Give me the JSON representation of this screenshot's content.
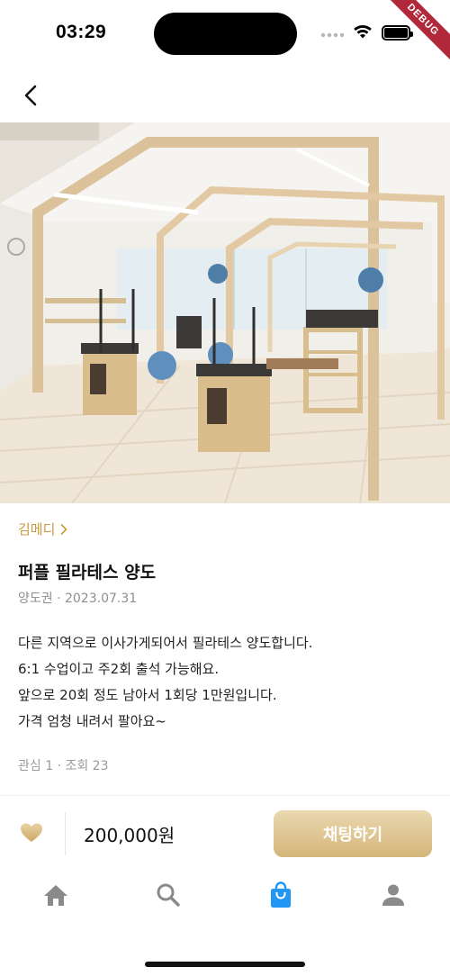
{
  "status_bar": {
    "time": "03:29",
    "debug_label": "DEBUG"
  },
  "header": {
    "back_icon": "chevron-left-icon"
  },
  "listing": {
    "seller_name": "김메디",
    "title": "퍼플 필라테스 양도",
    "meta": "양도권 · 2023.07.31",
    "description_lines": [
      "다른 지역으로 이사가게되어서 필라테스 양도합니다.",
      "6:1 수업이고  주2회 출석 가능해요.",
      "앞으로 20회 정도 남아서 1회당 1만원입니다.",
      "가격 엄청 내려서 팔아요~"
    ],
    "stats": "관심 1 · 조회 23"
  },
  "action_bar": {
    "price": "200,000원",
    "chat_label": "채팅하기",
    "like_icon": "heart-icon"
  },
  "tab_bar": {
    "tabs": [
      {
        "icon": "home-icon",
        "active": false
      },
      {
        "icon": "search-icon",
        "active": false
      },
      {
        "icon": "shopping-bag-icon",
        "active": true
      },
      {
        "icon": "person-icon",
        "active": false
      }
    ]
  },
  "colors": {
    "accent_gold": "#c89a3c",
    "button_gold": "#d5b67a",
    "active_tab": "#2196f3",
    "inactive_tab": "#8a8a8a"
  }
}
